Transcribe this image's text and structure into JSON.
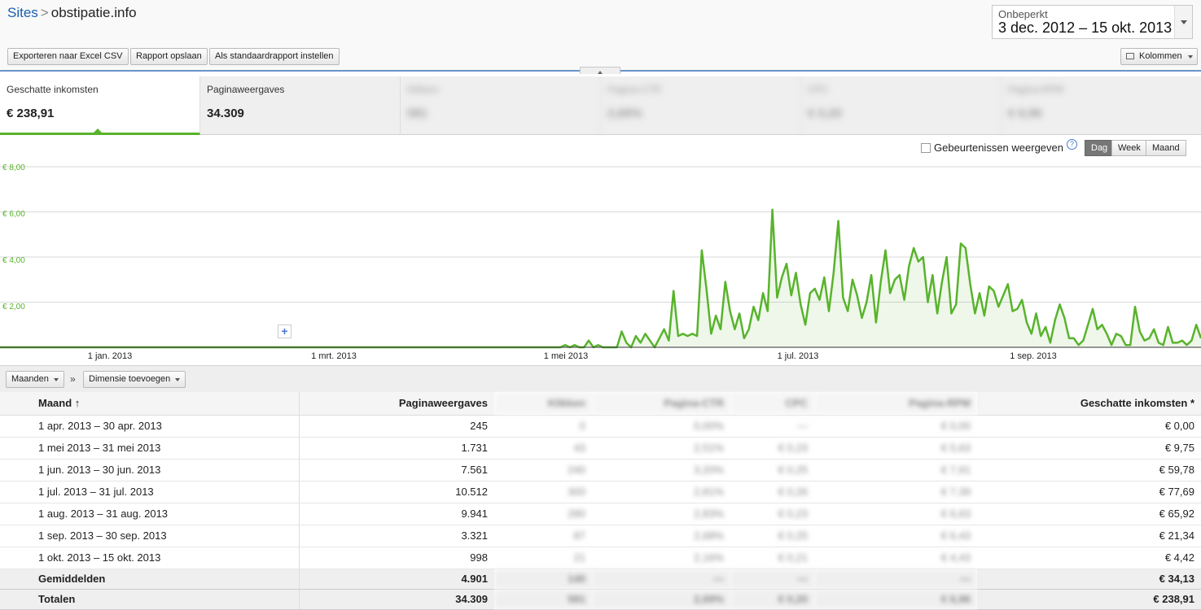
{
  "header": {
    "sites_link": "Sites",
    "separator": ">",
    "site_name": "obstipatie.info"
  },
  "date_range": {
    "label": "Onbeperkt",
    "value": "3 dec. 2012 – 15 okt. 2013"
  },
  "toolbar": {
    "export_label": "Exporteren naar Excel CSV",
    "save_label": "Rapport opslaan",
    "default_label": "Als standaardrapport instellen",
    "columns_label": "Kolommen"
  },
  "metric_tabs": [
    {
      "label": "Geschatte inkomsten",
      "value": "€ 238,91"
    },
    {
      "label": "Paginaweergaves",
      "value": "34.309"
    },
    {
      "label": "Klikken",
      "value": "581"
    },
    {
      "label": "Pagina-CTR",
      "value": "2,69%"
    },
    {
      "label": "CPC",
      "value": "€ 0,20"
    },
    {
      "label": "Pagina-RPM",
      "value": "€ 6,96"
    }
  ],
  "chart_controls": {
    "events_label": "Gebeurtenissen weergeven",
    "help_label": "?",
    "granularity": [
      "Dag",
      "Week",
      "Maand"
    ],
    "selected": "Dag"
  },
  "chart_data": {
    "type": "area",
    "series_color": "#58b32c",
    "y_ticks": [
      "€ 8,00",
      "€ 6,00",
      "€ 4,00",
      "€ 2,00"
    ],
    "ylim": [
      0,
      8
    ],
    "x_ticks": [
      "1 jan. 2013",
      "1 mrt. 2013",
      "1 mei 2013",
      "1 jul. 2013",
      "1 sep. 2013"
    ],
    "x_start": "2012-12-03",
    "x_end": "2013-10-15",
    "values": [
      0,
      0,
      0,
      0,
      0,
      0,
      0,
      0,
      0,
      0,
      0,
      0,
      0,
      0,
      0,
      0,
      0,
      0,
      0,
      0,
      0,
      0,
      0,
      0,
      0,
      0,
      0,
      0,
      0,
      0,
      0,
      0,
      0,
      0,
      0,
      0,
      0,
      0,
      0,
      0,
      0,
      0,
      0,
      0,
      0,
      0,
      0,
      0,
      0,
      0,
      0,
      0,
      0,
      0,
      0,
      0,
      0,
      0,
      0,
      0,
      0,
      0,
      0,
      0,
      0,
      0,
      0,
      0,
      0,
      0,
      0,
      0,
      0,
      0,
      0,
      0,
      0,
      0,
      0,
      0,
      0,
      0,
      0,
      0,
      0,
      0,
      0,
      0,
      0,
      0,
      0,
      0,
      0,
      0,
      0,
      0,
      0,
      0,
      0,
      0,
      0,
      0,
      0,
      0,
      0,
      0,
      0,
      0,
      0,
      0,
      0,
      0,
      0,
      0,
      0,
      0,
      0,
      0,
      0,
      0,
      0.1,
      0,
      0.1,
      0,
      0,
      0.3,
      0,
      0.1,
      0,
      0,
      0,
      0,
      0.7,
      0.2,
      0,
      0.5,
      0.2,
      0.6,
      0.3,
      0,
      0.4,
      0.8,
      0.3,
      2.5,
      0.5,
      0.6,
      0.5,
      0.6,
      0.5,
      4.3,
      2.6,
      0.6,
      1.4,
      0.8,
      2.9,
      1.6,
      0.8,
      1.5,
      0.4,
      0.8,
      1.8,
      1.2,
      2.4,
      1.6,
      6.1,
      2.2,
      3.1,
      3.7,
      2.3,
      3.3,
      1.9,
      1.0,
      2.4,
      2.6,
      2.1,
      3.1,
      1.6,
      3.3,
      5.6,
      2.2,
      1.6,
      3.0,
      2.3,
      1.3,
      2.0,
      3.2,
      1.1,
      2.9,
      4.3,
      2.4,
      3.0,
      3.2,
      2.1,
      3.6,
      4.4,
      3.8,
      4.0,
      2.0,
      3.2,
      1.5,
      2.9,
      4.0,
      1.5,
      1.9,
      4.6,
      4.4,
      2.8,
      1.5,
      2.4,
      1.4,
      2.7,
      2.5,
      1.8,
      2.3,
      2.8,
      1.6,
      1.7,
      2.1,
      1.1,
      0.6,
      1.5,
      0.5,
      0.9,
      0.2,
      1.2,
      1.9,
      1.3,
      0.4,
      0.4,
      0.1,
      0.3,
      1.0,
      1.7,
      0.8,
      1.0,
      0.6,
      0.1,
      0.6,
      0.5,
      0.1,
      0.1,
      1.8,
      0.7,
      0.3,
      0.4,
      0.8,
      0.2,
      0.1,
      0.9,
      0.2,
      0.2,
      0.3,
      0.1,
      0.3,
      1.0,
      0.4
    ]
  },
  "table": {
    "dimension_btn": "Maanden",
    "chevron": "»",
    "add_dimension_btn": "Dimensie toevoegen",
    "headers": [
      "Maand ↑",
      "Paginaweergaves",
      "Klikken",
      "Pagina-CTR",
      "CPC",
      "Pagina-RPM",
      "Geschatte inkomsten *"
    ],
    "rows": [
      [
        "1 apr. 2013 – 30 apr. 2013",
        "245",
        "0",
        "0,00%",
        "—",
        "€ 0,00",
        "€ 0,00"
      ],
      [
        "1 mei 2013 – 31 mei 2013",
        "1.731",
        "43",
        "2,51%",
        "€ 0,23",
        "€ 5,63",
        "€ 9,75"
      ],
      [
        "1 jun. 2013 – 30 jun. 2013",
        "7.561",
        "240",
        "3,20%",
        "€ 0,25",
        "€ 7,91",
        "€ 59,78"
      ],
      [
        "1 jul. 2013 – 31 jul. 2013",
        "10.512",
        "300",
        "2,81%",
        "€ 0,26",
        "€ 7,39",
        "€ 77,69"
      ],
      [
        "1 aug. 2013 – 31 aug. 2013",
        "9.941",
        "280",
        "2,83%",
        "€ 0,23",
        "€ 6,63",
        "€ 65,92"
      ],
      [
        "1 sep. 2013 – 30 sep. 2013",
        "3.321",
        "87",
        "2,68%",
        "€ 0,25",
        "€ 6,43",
        "€ 21,34"
      ],
      [
        "1 okt. 2013 – 15 okt. 2013",
        "998",
        "21",
        "2,16%",
        "€ 0,21",
        "€ 4,43",
        "€ 4,42"
      ]
    ],
    "average": [
      "Gemiddelden",
      "4.901",
      "140",
      "—",
      "—",
      "—",
      "€ 34,13"
    ],
    "total": [
      "Totalen",
      "34.309",
      "581",
      "2,69%",
      "€ 0,20",
      "€ 6,96",
      "€ 238,91"
    ]
  }
}
